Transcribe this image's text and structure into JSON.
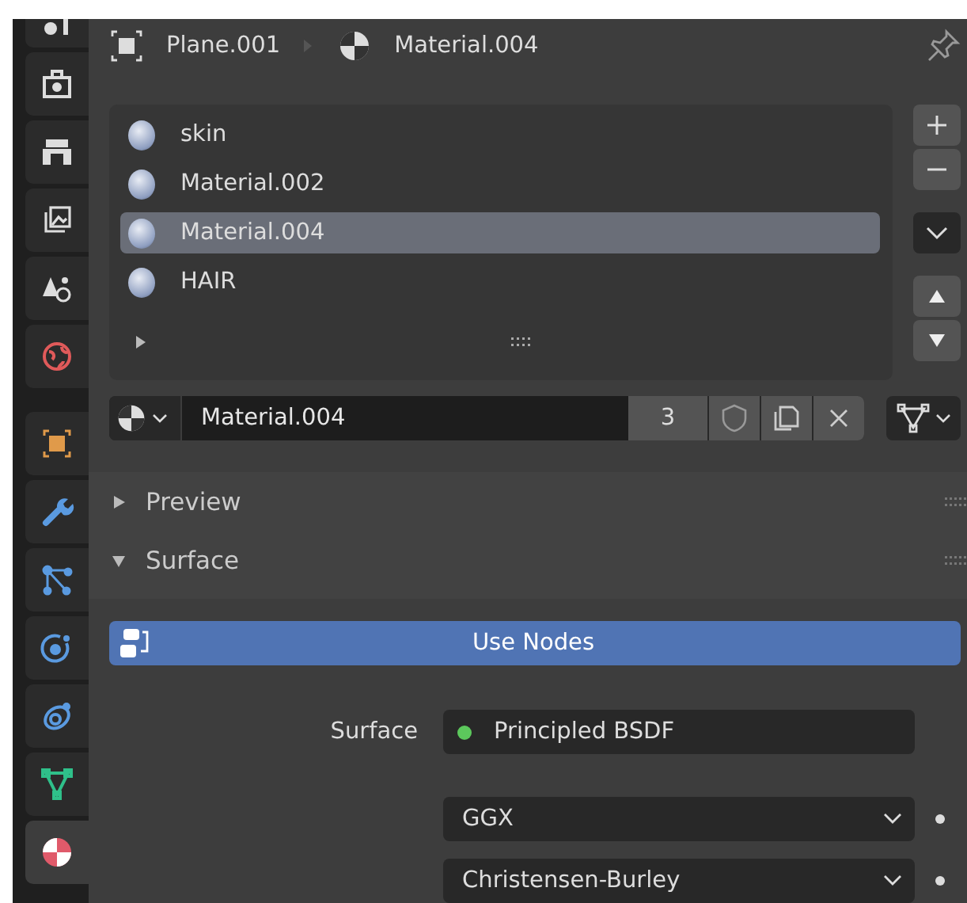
{
  "sidebar": {
    "tabs": [
      {
        "selected": false
      },
      {
        "selected": false
      },
      {
        "selected": false
      },
      {
        "selected": false
      },
      {
        "selected": false
      },
      {
        "selected": false
      },
      {
        "selected": false
      },
      {
        "selected": false
      },
      {
        "selected": false
      },
      {
        "selected": false
      },
      {
        "selected": false
      },
      {
        "selected": false
      },
      {
        "selected": true
      }
    ]
  },
  "breadcrumb": {
    "object": "Plane.001",
    "material": "Material.004"
  },
  "material_slots": [
    {
      "name": "skin",
      "selected": false
    },
    {
      "name": "Material.002",
      "selected": false
    },
    {
      "name": "Material.004",
      "selected": true
    },
    {
      "name": "HAIR",
      "selected": false
    }
  ],
  "datablock": {
    "name": "Material.004",
    "users": "3"
  },
  "panels": [
    {
      "title": "Preview",
      "expanded": false
    },
    {
      "title": "Surface",
      "expanded": true
    }
  ],
  "use_nodes": {
    "label": "Use Nodes",
    "on": true
  },
  "surface": {
    "label": "Surface",
    "value": "Principled BSDF"
  },
  "dropdowns": [
    "GGX",
    "Christensen-Burley"
  ]
}
